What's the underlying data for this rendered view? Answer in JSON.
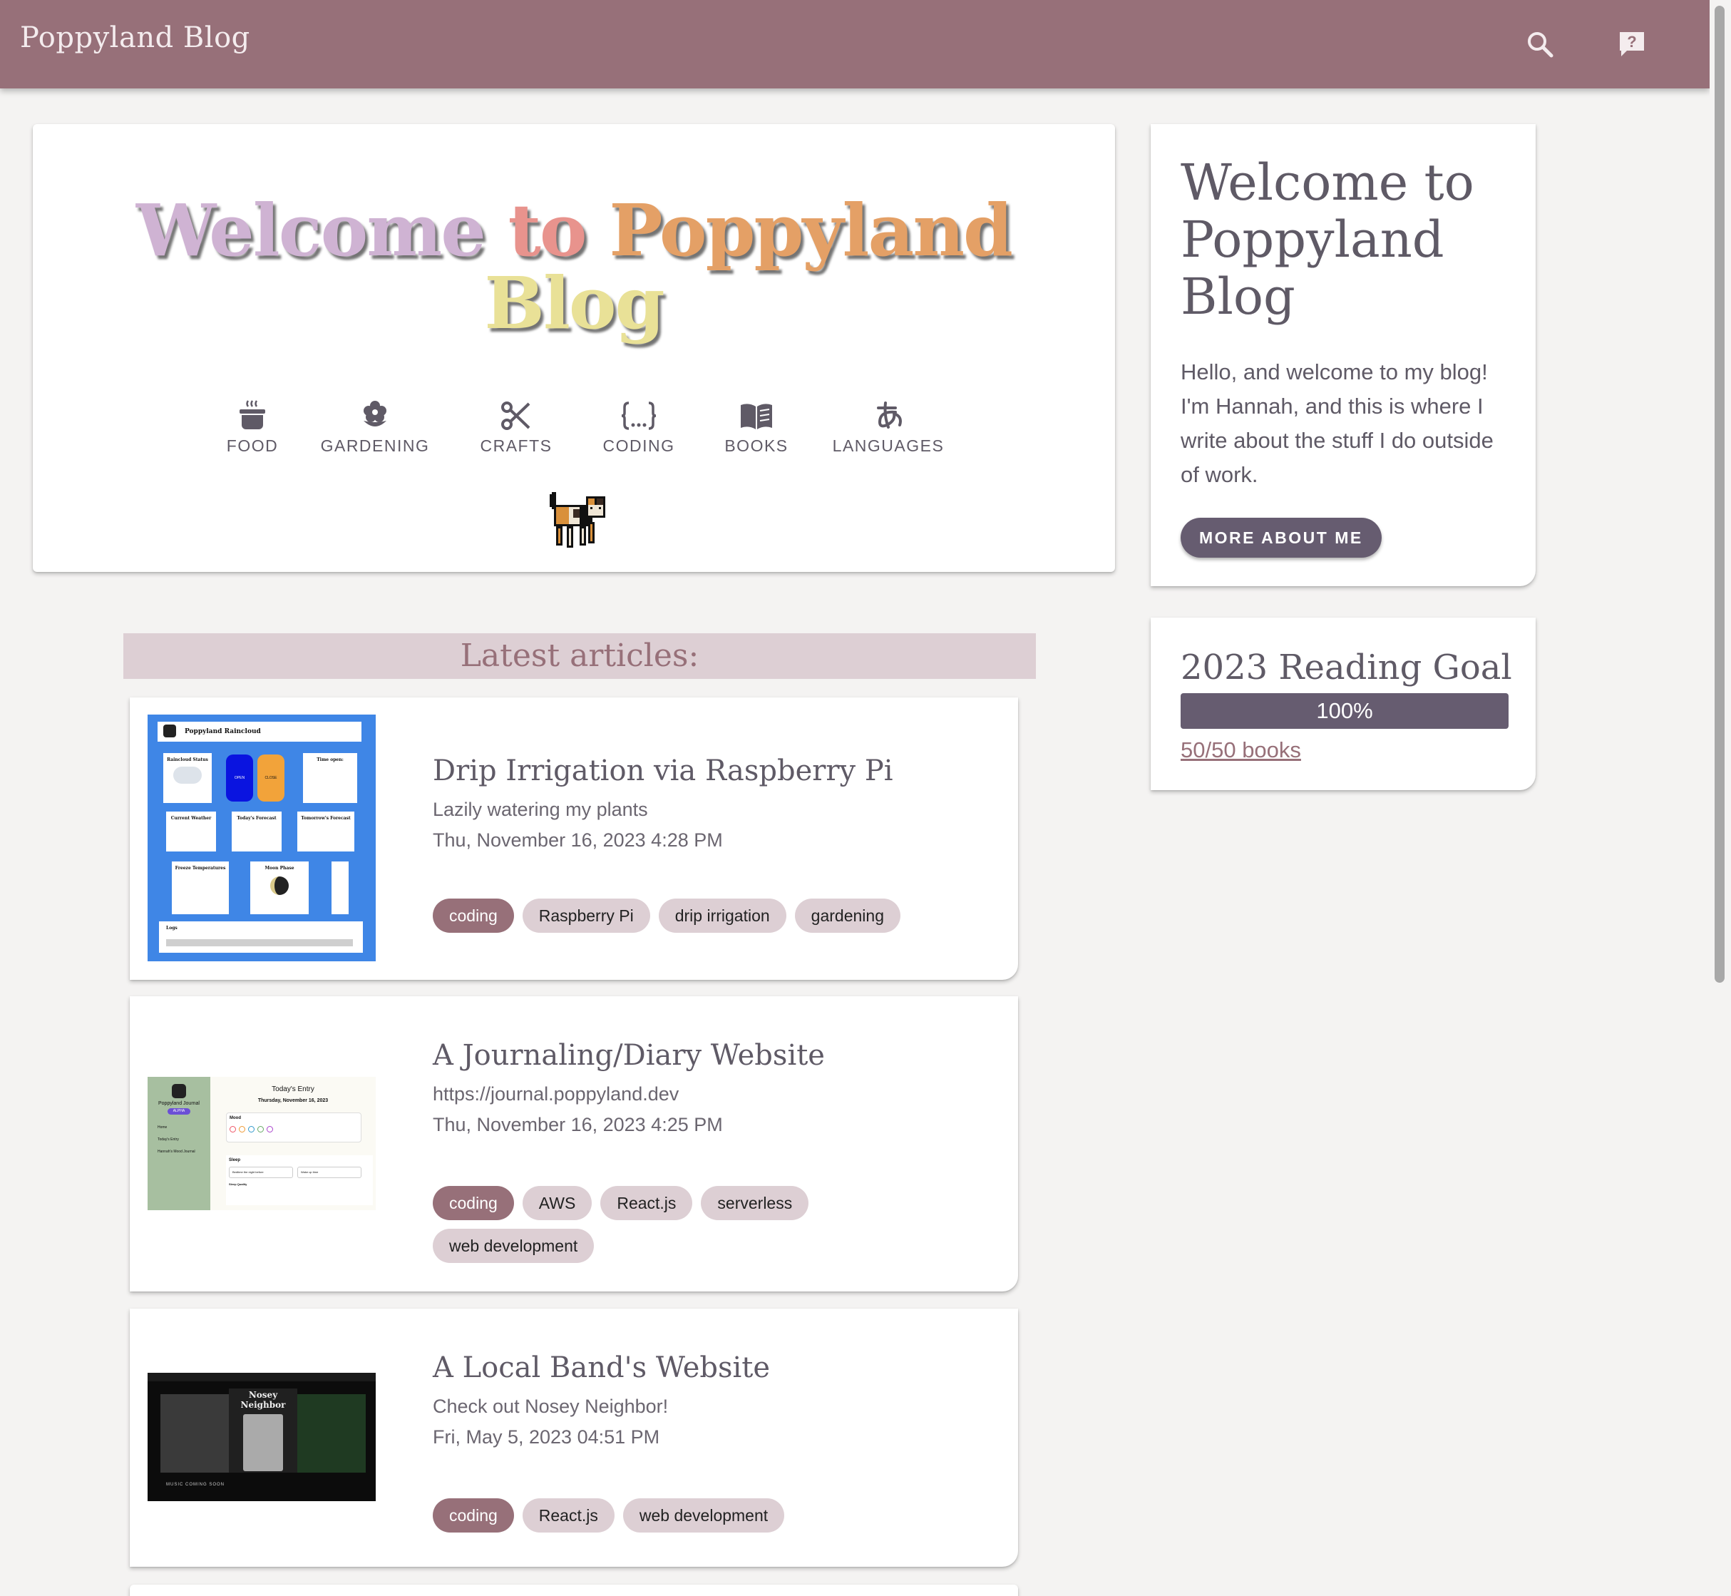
{
  "header": {
    "brand": "Poppyland Blog",
    "search_icon": "search-icon",
    "help_icon": "help-chat-icon"
  },
  "hero": {
    "title_words": [
      "Welcome",
      "to",
      "Poppyland",
      "Blog"
    ],
    "categories": [
      {
        "label": "FOOD",
        "icon": "cooking-pot-icon"
      },
      {
        "label": "GARDENING",
        "icon": "flower-icon"
      },
      {
        "label": "CRAFTS",
        "icon": "scissors-icon"
      },
      {
        "label": "CODING",
        "icon": "curly-braces-icon"
      },
      {
        "label": "BOOKS",
        "icon": "open-book-icon"
      },
      {
        "label": "LANGUAGES",
        "icon": "hiragana-a-icon"
      }
    ],
    "mascot": "pixel-calico-cat"
  },
  "latest": {
    "heading": "Latest articles:",
    "articles": [
      {
        "title": "Drip Irrigation via Raspberry Pi",
        "subtitle": "Lazily watering my plants",
        "date": "Thu, November 16, 2023 4:28 PM",
        "tags": [
          "coding",
          "Raspberry Pi",
          "drip irrigation",
          "gardening"
        ],
        "thumb": {
          "app_title": "Poppyland Raincloud",
          "panels": [
            "Raincloud Status",
            "Time open:",
            "Current Weather",
            "Today's Forecast",
            "Tomorrow's Forecast",
            "Freeze Temperatures",
            "Moon Phase",
            "Logs"
          ],
          "buttons": [
            "OPEN",
            "CLOSE"
          ]
        }
      },
      {
        "title": "A Journaling/Diary Website",
        "subtitle": "https://journal.poppyland.dev",
        "date": "Thu, November 16, 2023 4:25 PM",
        "tags": [
          "coding",
          "AWS",
          "React.js",
          "serverless",
          "web development"
        ],
        "thumb": {
          "app_title": "Poppyland Journal",
          "badge": "ALPHA",
          "nav": [
            "Home",
            "Today's Entry",
            "Hannah's Mood Journal"
          ],
          "entry_title": "Today's Entry",
          "entry_date": "Thursday, November 16, 2023",
          "sections": [
            "Mood",
            "Sleep"
          ],
          "fields": [
            "Bedtime the night before",
            "Wake up time",
            "Sleep Quality"
          ]
        }
      },
      {
        "title": "A Local Band's Website",
        "subtitle": "Check out Nosey Neighbor!",
        "date": "Fri, May 5, 2023 04:51 PM",
        "tags": [
          "coding",
          "React.js",
          "web development"
        ],
        "thumb": {
          "band_name": "Nosey Neighbor",
          "footer": "MUSIC COMING SOON"
        }
      }
    ]
  },
  "sidebar": {
    "about": {
      "title": "Welcome to Poppyland Blog",
      "text": "Hello, and welcome to my blog! I'm Hannah, and this is where I write about the stuff I do outside of work.",
      "button": "MORE ABOUT ME"
    },
    "goal": {
      "title": "2023 Reading Goal",
      "progress": 1.0,
      "percent_label": "100%",
      "link": "50/50 books"
    }
  },
  "colors": {
    "header": "#977079",
    "accent_dark": "#665c70",
    "tag": "#ddcfd4",
    "background": "#f4f3f2"
  }
}
